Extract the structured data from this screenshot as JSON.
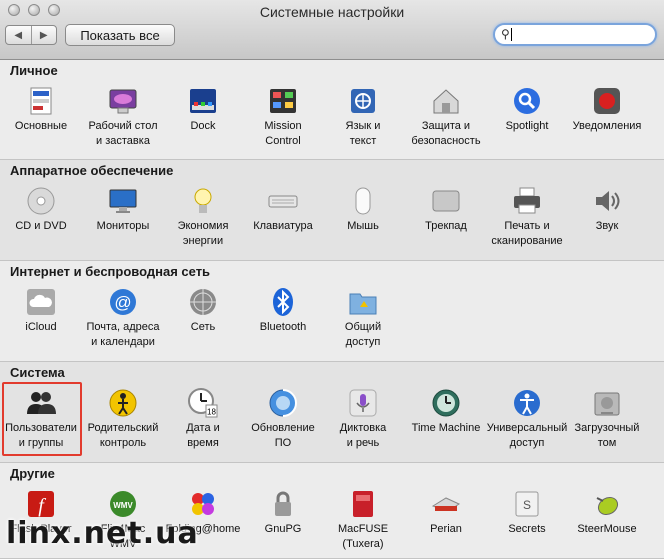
{
  "window": {
    "title": "Системные настройки",
    "show_all": "Показать все",
    "search": {
      "value": "",
      "placeholder": ""
    }
  },
  "sections": [
    {
      "title": "Личное",
      "items": [
        {
          "label": "Основные",
          "icon": "general-icon"
        },
        {
          "label": "Рабочий стол\nи заставка",
          "icon": "desktop-icon"
        },
        {
          "label": "Dock",
          "icon": "dock-icon"
        },
        {
          "label": "Mission\nControl",
          "icon": "mission-control-icon"
        },
        {
          "label": "Язык и\nтекст",
          "icon": "language-icon"
        },
        {
          "label": "Защита и\nбезопасность",
          "icon": "security-icon"
        },
        {
          "label": "Spotlight",
          "icon": "spotlight-icon"
        },
        {
          "label": "Уведомления",
          "icon": "notifications-icon"
        }
      ]
    },
    {
      "title": "Аппаратное обеспечение",
      "items": [
        {
          "label": "CD и DVD",
          "icon": "cd-dvd-icon"
        },
        {
          "label": "Мониторы",
          "icon": "displays-icon"
        },
        {
          "label": "Экономия\nэнергии",
          "icon": "energy-icon"
        },
        {
          "label": "Клавиатура",
          "icon": "keyboard-icon"
        },
        {
          "label": "Мышь",
          "icon": "mouse-icon"
        },
        {
          "label": "Трекпад",
          "icon": "trackpad-icon"
        },
        {
          "label": "Печать и\nсканирование",
          "icon": "printer-icon"
        },
        {
          "label": "Звук",
          "icon": "sound-icon"
        }
      ]
    },
    {
      "title": "Интернет и беспроводная сеть",
      "items": [
        {
          "label": "iCloud",
          "icon": "icloud-icon"
        },
        {
          "label": "Почта, адреса\nи календари",
          "icon": "mail-icon"
        },
        {
          "label": "Сеть",
          "icon": "network-icon"
        },
        {
          "label": "Bluetooth",
          "icon": "bluetooth-icon"
        },
        {
          "label": "Общий\nдоступ",
          "icon": "sharing-icon"
        }
      ]
    },
    {
      "title": "Система",
      "items": [
        {
          "label": "Пользователи\nи группы",
          "icon": "users-icon"
        },
        {
          "label": "Родительский\nконтроль",
          "icon": "parental-icon"
        },
        {
          "label": "Дата и\nвремя",
          "icon": "datetime-icon"
        },
        {
          "label": "Обновление\nПО",
          "icon": "update-icon"
        },
        {
          "label": "Диктовка\nи речь",
          "icon": "dictation-icon"
        },
        {
          "label": "Time Machine",
          "icon": "time-machine-icon"
        },
        {
          "label": "Универсальный\nдоступ",
          "icon": "accessibility-icon"
        },
        {
          "label": "Загрузочный\nтом",
          "icon": "startup-disk-icon"
        }
      ]
    },
    {
      "title": "Другие",
      "items": [
        {
          "label": "Flash Player",
          "icon": "flash-icon"
        },
        {
          "label": "Flip4Mac\nWMV",
          "icon": "flip4mac-icon"
        },
        {
          "label": "Folding@home",
          "icon": "folding-icon"
        },
        {
          "label": "GnuPG",
          "icon": "gnupg-icon"
        },
        {
          "label": "MacFUSE\n(Tuxera)",
          "icon": "macfuse-icon"
        },
        {
          "label": "Perian",
          "icon": "perian-icon"
        },
        {
          "label": "Secrets",
          "icon": "secrets-icon"
        },
        {
          "label": "SteerMouse",
          "icon": "steermouse-icon"
        }
      ]
    }
  ],
  "watermark": "linx.net.ua",
  "colors": {
    "selection": "#e23b2e",
    "search_focus": "#7aa4dc"
  }
}
